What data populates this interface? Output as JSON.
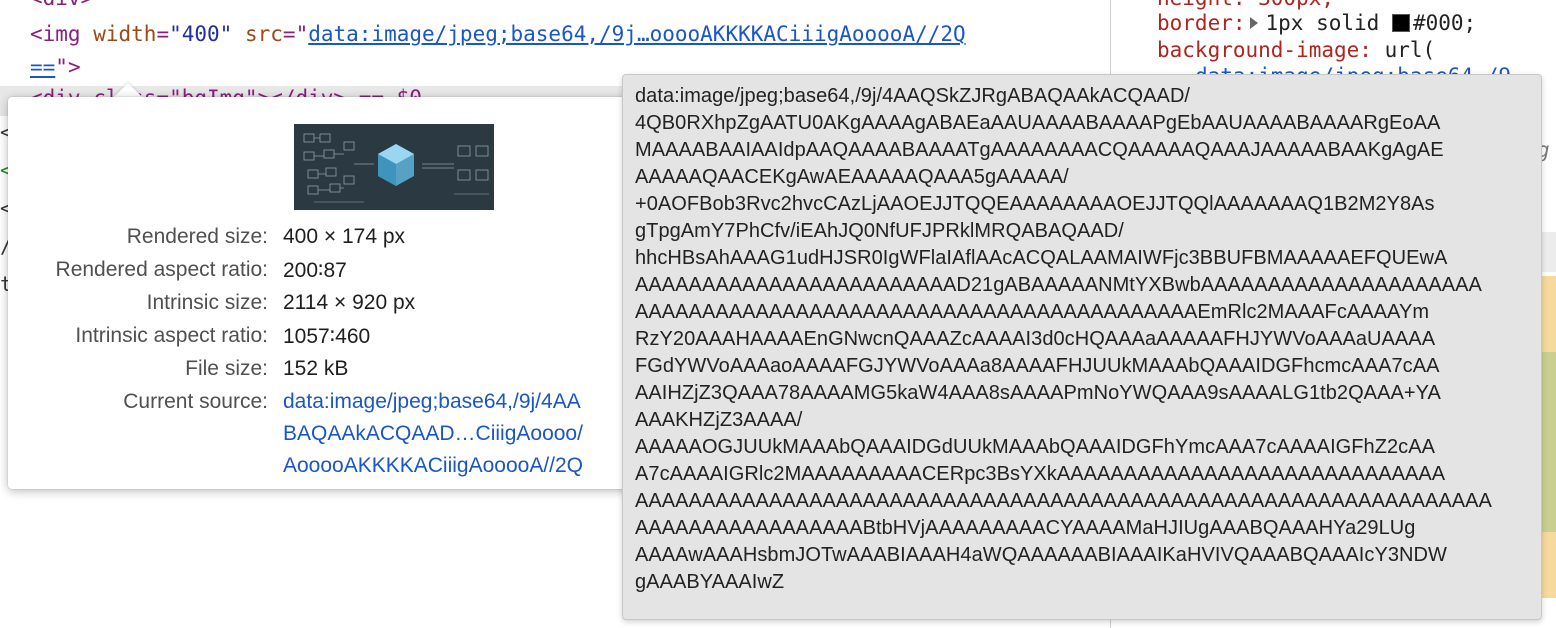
{
  "elements": {
    "line_top": "<div>",
    "img_line": {
      "open": "<img",
      "width_attr": "width",
      "width_val": "\"400\"",
      "src_attr": "src",
      "src_val": "data:image/jpeg;base64,/9j…ooooAKKKKACiiigAooooA//2Q",
      "src_tail": "==",
      "close": "\">"
    },
    "div_line": "<div class=\"bgImg\"></div> == $0"
  },
  "styles": {
    "height_line": "height: 300px;",
    "border_prop": "border:",
    "border_val": "1px solid",
    "border_color": "#000;",
    "bg_prop": "background-image:",
    "bg_val": "url(",
    "bg_url_partial": "data:image/jpeg;base64,/9"
  },
  "tooltip": {
    "rows": [
      {
        "label": "Rendered size:",
        "value": "400 × 174 px"
      },
      {
        "label": "Rendered aspect ratio:",
        "value": "200∶87"
      },
      {
        "label": "Intrinsic size:",
        "value": "2114 × 920 px"
      },
      {
        "label": "Intrinsic aspect ratio:",
        "value": "1057∶460"
      },
      {
        "label": "File size:",
        "value": "152 kB"
      },
      {
        "label": "Current source:",
        "value": "data:image/jpeg;base64,/9j/4AA"
      }
    ],
    "source_lines": [
      "BAQAAkACQAAD…CiiigAoooo/",
      "AooooAKKKKACiiigAooooA//2Q"
    ]
  },
  "popover": {
    "lines": [
      "data:image/jpeg;base64,/9j/4AAQSkZJRgABAQAAkACQAAD/",
      "4QB0RXhpZgAATU0AKgAAAAgABAEaAAUAAAABAAAAPgEbAAUAAAABAAAARgEoAA",
      "MAAAABAAIAAIdpAAQAAAABAAAATgAAAAAAAACQAAAAAQAAAJAAAAABAAKgAgAE",
      "AAAAAQAACEKgAwAEAAAAAQAAA5gAAAAA/",
      "+0AOFBob3Rvc2hvcCAzLjAAOEJJTQQEAAAAAAAAOEJJTQQlAAAAAAAQ1B2M2Y8As",
      "gTpgAmY7PhCfv/iEAhJQ0NfUFJPRklMRQABAQAAD/",
      "hhcHBsAhAAAG1udHJSR0IgWFlaIAflAAcACQALAAMAIWFjc3BBUFBMAAAAAEFQUEwA",
      "AAAAAAAAAAAAAAAAAAAAAAAAD21gABAAAAANMtYXBwbAAAAAAAAAAAAAAAAAAAAA",
      "AAAAAAAAAAAAAAAAAAAAAAAAAAAAAAAAAAAAAAAAAAEmRlc2MAAAFcAAAAYm",
      "RzY20AAAHAAAAEnGNwcnQAAAZcAAAAI3d0cHQAAAaAAAAAFHJYWVoAAAaUAAAA",
      "FGdYWVoAAAaoAAAAFGJYWVoAAAa8AAAAFHJUUkMAAAbQAAAIDGFhcmcAAA7cAA",
      "AAIHZjZ3QAAA78AAAAMG5kaW4AAA8sAAAAPmNoYWQAAA9sAAAALG1tb2QAAA+YA",
      "AAAKHZjZ3AAAA/",
      "AAAAAOGJUUkMAAAbQAAAIDGdUUkMAAAbQAAAIDGFhYmcAAA7cAAAAIGFhZ2cAA",
      "A7cAAAAIGRlc2MAAAAAAAAACERpc3BsYXkAAAAAAAAAAAAAAAAAAAAAAAAAAAAA",
      "AAAAAAAAAAAAAAAAAAAAAAAAAAAAAAAAAAAAAAAAAAAAAAAAAAAAAAAAAAAAAAAA",
      "AAAAAAAAAAAAAAAAABtbHVjAAAAAAAAACYAAAAMaHJIUgAAABQAAAHYa29LUg",
      "AAAAwAAAHsbmJOTwAAABIAAAH4aWQAAAAAABIAAAIKaHVIVQAAABQAAAIcY3NDW",
      "gAAABYAAAIwZ"
    ]
  },
  "colors": {
    "border_swatch": "#000000",
    "source_link": "#1a56c8"
  }
}
